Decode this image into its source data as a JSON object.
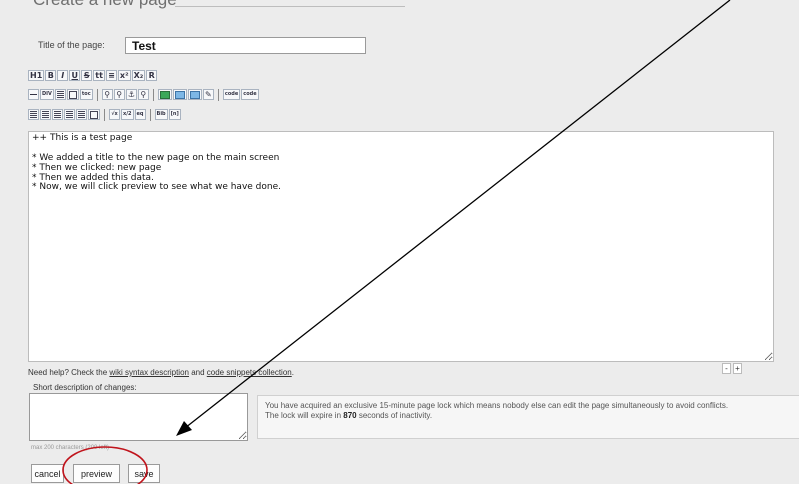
{
  "page": {
    "heading": "Create a new page",
    "title_label": "Title of the page:",
    "title_value": "Test"
  },
  "toolbar": {
    "row1": [
      {
        "name": "heading1-button",
        "label": "H1"
      },
      {
        "name": "bold-button",
        "label": "B"
      },
      {
        "name": "italic-button",
        "label": "I"
      },
      {
        "name": "underline-button",
        "label": "U"
      },
      {
        "name": "strikethrough-button",
        "label": "S"
      },
      {
        "name": "teletype-button",
        "label": "tt"
      },
      {
        "name": "center-button",
        "label": "≡"
      },
      {
        "name": "superscript-button",
        "label": "x²"
      },
      {
        "name": "subscript-button",
        "label": "X₂"
      },
      {
        "name": "raw-button",
        "label": "R"
      }
    ],
    "row2_text": {
      "div": "DIV",
      "toc": "toc",
      "code": "code",
      "code2": "code"
    },
    "row3_text": {
      "sqrt": "√x",
      "frac": "x/2",
      "bib": "Bib",
      "ref": "[n]"
    }
  },
  "editor": {
    "content": "++ This is a test page\n\n* We added a title to the new page on the main screen\n* Then we clicked: new page\n* Then we added this data.\n* Now, we will click preview to see what we have done."
  },
  "help": {
    "prefix": "Need help? Check the ",
    "wiki_link": "wiki syntax description",
    "middle": " and ",
    "snippets_link": "code snippets collection",
    "suffix": "."
  },
  "resize": {
    "minus": "-",
    "plus": "+"
  },
  "changes": {
    "label": "Short description of changes:",
    "max_chars": "max 200 characters (200 left)"
  },
  "lock": {
    "message": "You have acquired an exclusive 15-minute page lock which means nobody else can edit the page simultaneously to avoid conflicts.",
    "expire_prefix": "The lock will expire in ",
    "seconds": "870",
    "expire_suffix": " seconds of inactivity."
  },
  "buttons": {
    "cancel": "cancel",
    "preview": "preview",
    "save": "save"
  },
  "annotation": {
    "arrow_color": "#000000",
    "circle_color": "#c0141c"
  }
}
